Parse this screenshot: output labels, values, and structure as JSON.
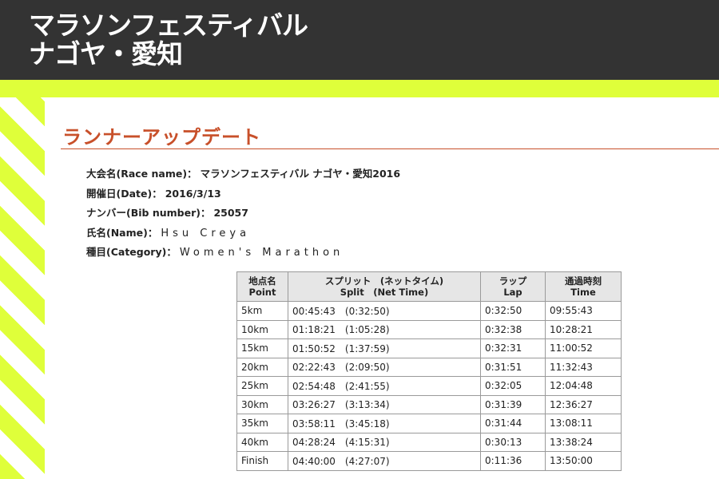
{
  "header": {
    "title_line1": "マラソンフェスティバル",
    "title_line2": "ナゴヤ・愛知"
  },
  "page_title": "ランナーアップデート",
  "info": [
    {
      "label": "大会名(Race name)：",
      "value": "マラソンフェスティバル ナゴヤ・愛知2016"
    },
    {
      "label": "開催日(Date)：",
      "value": "2016/3/13"
    },
    {
      "label": "ナンバー(Bib number)：",
      "value": "25057"
    },
    {
      "label": "氏名(Name)：",
      "value": "Hsu Creya"
    },
    {
      "label": "種目(Category)：",
      "value": "Women's Marathon"
    }
  ],
  "table": {
    "headers": [
      {
        "jp": "地点名",
        "en": "Point"
      },
      {
        "jp": "スプリット　(ネットタイム)",
        "en": "Split　(Net Time)"
      },
      {
        "jp": "ラップ",
        "en": "Lap"
      },
      {
        "jp": "通過時刻",
        "en": "Time"
      }
    ],
    "rows": [
      {
        "point": "5km",
        "split": "00:45:43　(0:32:50)",
        "lap": "0:32:50",
        "time": "09:55:43"
      },
      {
        "point": "10km",
        "split": "01:18:21　(1:05:28)",
        "lap": "0:32:38",
        "time": "10:28:21"
      },
      {
        "point": "15km",
        "split": "01:50:52　(1:37:59)",
        "lap": "0:32:31",
        "time": "11:00:52"
      },
      {
        "point": "20km",
        "split": "02:22:43　(2:09:50)",
        "lap": "0:31:51",
        "time": "11:32:43"
      },
      {
        "point": "25km",
        "split": "02:54:48　(2:41:55)",
        "lap": "0:32:05",
        "time": "12:04:48"
      },
      {
        "point": "30km",
        "split": "03:26:27　(3:13:34)",
        "lap": "0:31:39",
        "time": "12:36:27"
      },
      {
        "point": "35km",
        "split": "03:58:11　(3:45:18)",
        "lap": "0:31:44",
        "time": "13:08:11"
      },
      {
        "point": "40km",
        "split": "04:28:24　(4:15:31)",
        "lap": "0:30:13",
        "time": "13:38:24"
      },
      {
        "point": "Finish",
        "split": "04:40:00　(4:27:07)",
        "lap": "0:11:36",
        "time": "13:50:00"
      }
    ]
  },
  "colors": {
    "header_bg": "#333333",
    "accent_stripe": "#dfff3a",
    "title_color": "#c8502a",
    "table_header_bg": "#e6e6e6"
  }
}
